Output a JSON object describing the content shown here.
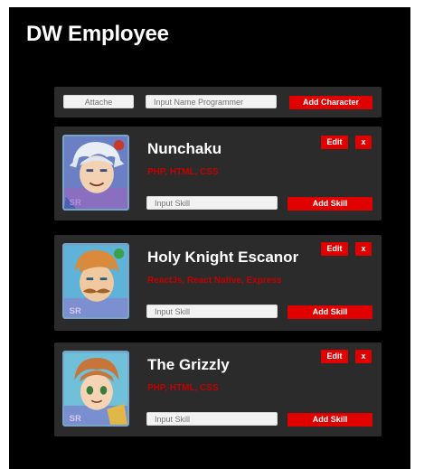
{
  "app": {
    "title": "DW Employee"
  },
  "form": {
    "attache_placeholder": "Attache",
    "name_placeholder": "Input Name Programmer",
    "add_label": "Add Character"
  },
  "characters": [
    {
      "name": "Nunchaku",
      "skills": "PHP, HTML, CSS",
      "edit_label": "Edit",
      "delete_label": "x",
      "skill_placeholder": "Input Skill",
      "add_skill_label": "Add Skill"
    },
    {
      "name": "Holy Knight Escanor",
      "skills": "ReactJs, React Native, Express",
      "edit_label": "Edit",
      "delete_label": "x",
      "skill_placeholder": "Input Skill",
      "add_skill_label": "Add Skill"
    },
    {
      "name": "The Grizzly",
      "skills": "PHP, HTML, CSS",
      "edit_label": "Edit",
      "delete_label": "x",
      "skill_placeholder": "Input Skill",
      "add_skill_label": "Add Skill"
    }
  ],
  "colors": {
    "background": "#000000",
    "card": "#2b2b2b",
    "accent_red": "#e00000",
    "skill_text": "#c40000"
  }
}
